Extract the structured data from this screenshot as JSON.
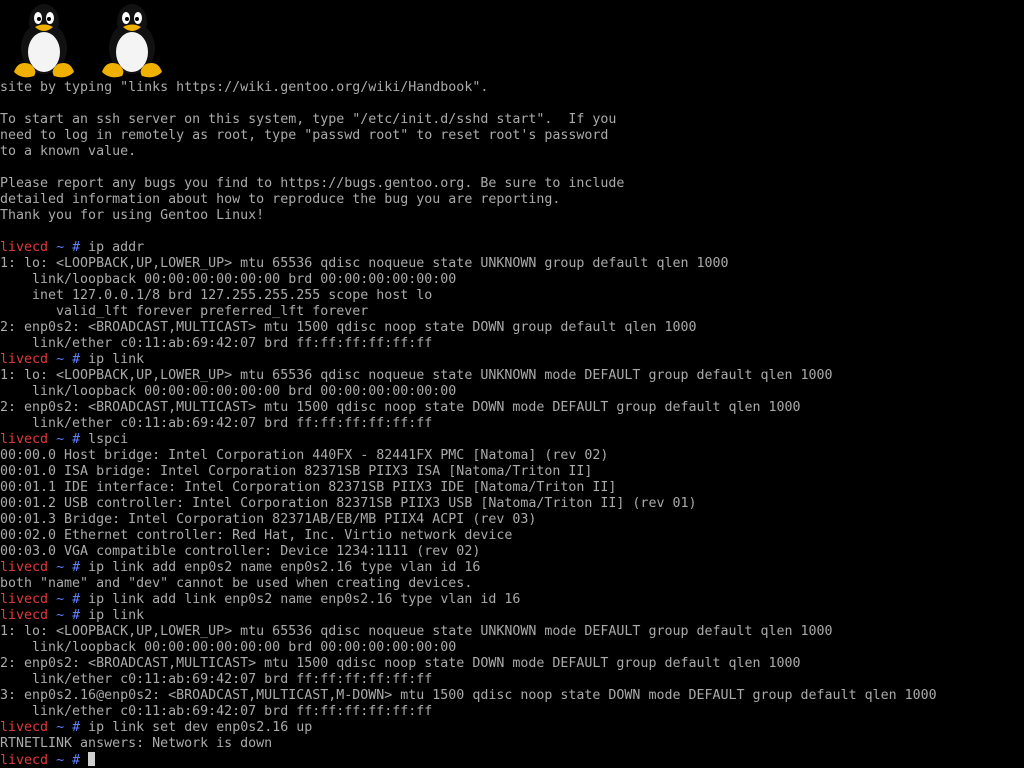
{
  "console": {
    "logo_count": 2,
    "colors": {
      "background": "#000000",
      "text": "#aaaaaa",
      "prompt_host": "#e23a3a",
      "prompt_path": "#5f7fff"
    },
    "lines": [
      {
        "type": "text",
        "text": "site by typing \"links https://wiki.gentoo.org/wiki/Handbook\"."
      },
      {
        "type": "text",
        "text": ""
      },
      {
        "type": "text",
        "text": "To start an ssh server on this system, type \"/etc/init.d/sshd start\".  If you"
      },
      {
        "type": "text",
        "text": "need to log in remotely as root, type \"passwd root\" to reset root's password"
      },
      {
        "type": "text",
        "text": "to a known value."
      },
      {
        "type": "text",
        "text": ""
      },
      {
        "type": "text",
        "text": "Please report any bugs you find to https://bugs.gentoo.org. Be sure to include"
      },
      {
        "type": "text",
        "text": "detailed information about how to reproduce the bug you are reporting."
      },
      {
        "type": "text",
        "text": "Thank you for using Gentoo Linux!"
      },
      {
        "type": "text",
        "text": ""
      },
      {
        "type": "prompt",
        "host": "livecd",
        "path": "~",
        "symbol": "#",
        "cmd": "ip addr"
      },
      {
        "type": "text",
        "text": "1: lo: <LOOPBACK,UP,LOWER_UP> mtu 65536 qdisc noqueue state UNKNOWN group default qlen 1000"
      },
      {
        "type": "text",
        "text": "    link/loopback 00:00:00:00:00:00 brd 00:00:00:00:00:00"
      },
      {
        "type": "text",
        "text": "    inet 127.0.0.1/8 brd 127.255.255.255 scope host lo"
      },
      {
        "type": "text",
        "text": "       valid_lft forever preferred_lft forever"
      },
      {
        "type": "text",
        "text": "2: enp0s2: <BROADCAST,MULTICAST> mtu 1500 qdisc noop state DOWN group default qlen 1000"
      },
      {
        "type": "text",
        "text": "    link/ether c0:11:ab:69:42:07 brd ff:ff:ff:ff:ff:ff"
      },
      {
        "type": "prompt",
        "host": "livecd",
        "path": "~",
        "symbol": "#",
        "cmd": "ip link"
      },
      {
        "type": "text",
        "text": "1: lo: <LOOPBACK,UP,LOWER_UP> mtu 65536 qdisc noqueue state UNKNOWN mode DEFAULT group default qlen 1000"
      },
      {
        "type": "text",
        "text": "    link/loopback 00:00:00:00:00:00 brd 00:00:00:00:00:00"
      },
      {
        "type": "text",
        "text": "2: enp0s2: <BROADCAST,MULTICAST> mtu 1500 qdisc noop state DOWN mode DEFAULT group default qlen 1000"
      },
      {
        "type": "text",
        "text": "    link/ether c0:11:ab:69:42:07 brd ff:ff:ff:ff:ff:ff"
      },
      {
        "type": "prompt",
        "host": "livecd",
        "path": "~",
        "symbol": "#",
        "cmd": "lspci"
      },
      {
        "type": "text",
        "text": "00:00.0 Host bridge: Intel Corporation 440FX - 82441FX PMC [Natoma] (rev 02)"
      },
      {
        "type": "text",
        "text": "00:01.0 ISA bridge: Intel Corporation 82371SB PIIX3 ISA [Natoma/Triton II]"
      },
      {
        "type": "text",
        "text": "00:01.1 IDE interface: Intel Corporation 82371SB PIIX3 IDE [Natoma/Triton II]"
      },
      {
        "type": "text",
        "text": "00:01.2 USB controller: Intel Corporation 82371SB PIIX3 USB [Natoma/Triton II] (rev 01)"
      },
      {
        "type": "text",
        "text": "00:01.3 Bridge: Intel Corporation 82371AB/EB/MB PIIX4 ACPI (rev 03)"
      },
      {
        "type": "text",
        "text": "00:02.0 Ethernet controller: Red Hat, Inc. Virtio network device"
      },
      {
        "type": "text",
        "text": "00:03.0 VGA compatible controller: Device 1234:1111 (rev 02)"
      },
      {
        "type": "prompt",
        "host": "livecd",
        "path": "~",
        "symbol": "#",
        "cmd": "ip link add enp0s2 name enp0s2.16 type vlan id 16"
      },
      {
        "type": "text",
        "text": "both \"name\" and \"dev\" cannot be used when creating devices."
      },
      {
        "type": "prompt",
        "host": "livecd",
        "path": "~",
        "symbol": "#",
        "cmd": "ip link add link enp0s2 name enp0s2.16 type vlan id 16"
      },
      {
        "type": "prompt",
        "host": "livecd",
        "path": "~",
        "symbol": "#",
        "cmd": "ip link"
      },
      {
        "type": "text",
        "text": "1: lo: <LOOPBACK,UP,LOWER_UP> mtu 65536 qdisc noqueue state UNKNOWN mode DEFAULT group default qlen 1000"
      },
      {
        "type": "text",
        "text": "    link/loopback 00:00:00:00:00:00 brd 00:00:00:00:00:00"
      },
      {
        "type": "text",
        "text": "2: enp0s2: <BROADCAST,MULTICAST> mtu 1500 qdisc noop state DOWN mode DEFAULT group default qlen 1000"
      },
      {
        "type": "text",
        "text": "    link/ether c0:11:ab:69:42:07 brd ff:ff:ff:ff:ff:ff"
      },
      {
        "type": "text",
        "text": "3: enp0s2.16@enp0s2: <BROADCAST,MULTICAST,M-DOWN> mtu 1500 qdisc noop state DOWN mode DEFAULT group default qlen 1000"
      },
      {
        "type": "text",
        "text": "    link/ether c0:11:ab:69:42:07 brd ff:ff:ff:ff:ff:ff"
      },
      {
        "type": "prompt",
        "host": "livecd",
        "path": "~",
        "symbol": "#",
        "cmd": "ip link set dev enp0s2.16 up"
      },
      {
        "type": "text",
        "text": "RTNETLINK answers: Network is down"
      },
      {
        "type": "prompt",
        "host": "livecd",
        "path": "~",
        "symbol": "#",
        "cmd": "",
        "cursor": true
      }
    ]
  }
}
